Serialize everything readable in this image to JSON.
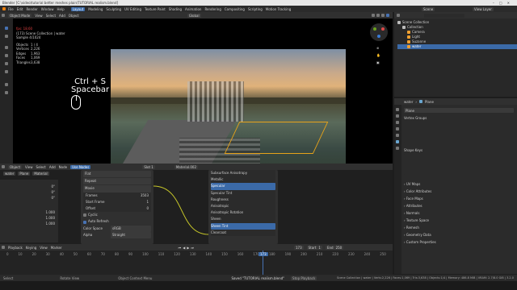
{
  "window": {
    "title": "Blender [C:\\video\\tutorial better meshes plain\\TUTORIAL realism.blend]"
  },
  "menu": [
    "File",
    "Edit",
    "Render",
    "Window",
    "Help"
  ],
  "workspaces": [
    "Layout",
    "Modeling",
    "Sculpting",
    "UV Editing",
    "Texture Paint",
    "Shading",
    "Animation",
    "Rendering",
    "Compositing",
    "Scripting",
    "Motion Tracking"
  ],
  "scene": {
    "label": "Scene",
    "view_layer": "View Layer"
  },
  "viewport": {
    "mode": "Object Mode",
    "menus": [
      "View",
      "Select",
      "Add",
      "Object"
    ],
    "orient": "Global",
    "stats": {
      "fps": "fps: 18.60",
      "collection": "(173) Scene Collection | water",
      "samples": "Sample 4/1024",
      "rows": [
        {
          "k": "Objects",
          "v": "1 / 4"
        },
        {
          "k": "Vertices",
          "v": "2,226"
        },
        {
          "k": "Edges",
          "v": "1,963"
        },
        {
          "k": "Faces",
          "v": "1,069"
        },
        {
          "k": "Triangles",
          "v": "3,638"
        }
      ]
    },
    "overlay": {
      "keys": "Ctrl + S",
      "space": "Spacebar"
    }
  },
  "outliner": {
    "title": "Scene Collection",
    "items": [
      "Collection",
      "Camera",
      "Light",
      "Suzanne",
      "water"
    ]
  },
  "properties": {
    "obj_name": "water",
    "mesh": "Plane",
    "data_name": "Plane",
    "panels_top": [
      "Vertex Groups",
      "Shape Keys"
    ],
    "panels": [
      "UV Maps",
      "Color Attributes",
      "Face Maps",
      "Attributes",
      "Normals",
      "Texture Space",
      "Remesh",
      "Geometry Data",
      "Custom Properties"
    ]
  },
  "node_editor": {
    "menus": [
      "Object",
      "View",
      "Select",
      "Add",
      "Node"
    ],
    "use_nodes": "Use Nodes",
    "slot": "Slot 1",
    "material": "Material.002",
    "object_field": "water",
    "plane_field": "Plane",
    "mat_field": "Material",
    "numbers": [
      "0°",
      "0°",
      "0°",
      "1.000",
      "1.000",
      "1.000"
    ],
    "texture": {
      "proj": "Flat",
      "ext": "Repeat",
      "src": "Movie",
      "frames": {
        "k": "Frames",
        "v": "3503"
      },
      "start": {
        "k": "Start Frame",
        "v": "1"
      },
      "offset": {
        "k": "Offset",
        "v": "0"
      },
      "cyclic": "Cyclic",
      "auto": "Auto Refresh",
      "color_space": {
        "k": "Color Space",
        "v": "sRGB"
      },
      "alpha": {
        "k": "Alpha",
        "v": "Straight"
      }
    },
    "bsdf": [
      "Subsurface Anisotropy",
      "Metallic",
      "Specular",
      "Specular Tint",
      "Roughness",
      "Anisotropic",
      "Anisotropic Rotation",
      "Sheen",
      "Sheen Tint",
      "Clearcoat"
    ]
  },
  "timeline": {
    "menus": [
      "Playback",
      "Keying",
      "View",
      "Marker"
    ],
    "current": "173",
    "start_label": "Start",
    "start": "1",
    "end_label": "End",
    "end": "250",
    "ticks": [
      "0",
      "10",
      "20",
      "30",
      "40",
      "50",
      "60",
      "70",
      "80",
      "90",
      "100",
      "110",
      "120",
      "130",
      "140",
      "150",
      "160",
      "170",
      "180",
      "190",
      "200",
      "210",
      "220",
      "230",
      "240",
      "250"
    ]
  },
  "status": {
    "select": "Select",
    "rotate": "Rotate View",
    "context": "Object Context Menu",
    "saved": "Saved \"TUTORIAL realism.blend\"",
    "playback": "Stop Playback",
    "right": "Scene Collection | water | Verts:2,226 | Faces:1,069 | Tris:3,638 | Objects:1/4 | Memory: 486.8 MiB | VRAM: 2.7/8.0 GiB | 3.2.0"
  }
}
